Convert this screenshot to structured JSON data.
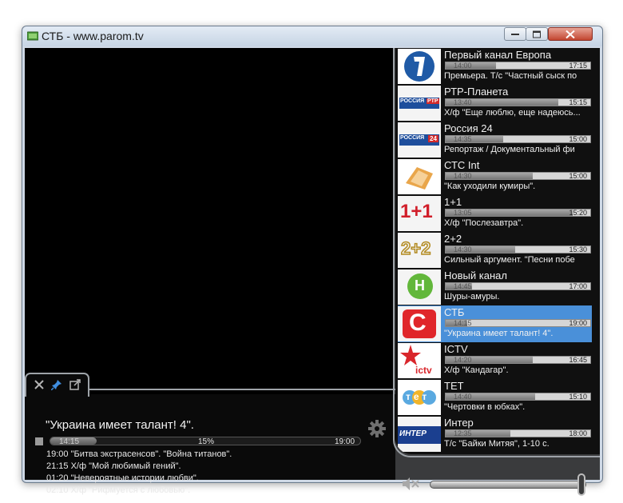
{
  "window": {
    "title": "СТБ - www.parom.tv"
  },
  "info": {
    "current_title": "\"Украина имеет талант! 4\".",
    "progress": {
      "start": "14:15",
      "percent_label": "15%",
      "end": "19:00",
      "fraction": 0.15
    },
    "schedule": [
      "19:00 \"Битва экстрасенсов\". \"Война титанов\".",
      "21:15 Х/ф \"Мой любимый гений\".",
      "01:20 \"Невероятные истории любви\".",
      "02:10 Х/ф \"Рифмуется с любовью\"."
    ]
  },
  "channels": [
    {
      "name": "Первый канал Европа",
      "start": "14:00",
      "end": "17:15",
      "program": "Премьера. Т/с \"Частный сыск по",
      "fraction": 0.35,
      "logo": "pervyi-logo",
      "active": false
    },
    {
      "name": "РТР-Планета",
      "start": "13:40",
      "end": "15:15",
      "program": "Х/ф \"Еще люблю, еще надеюсь...",
      "fraction": 0.78,
      "logo": "rtr-logo",
      "logo_text": "РОССИЯ",
      "logo_badge": "РТР",
      "active": false
    },
    {
      "name": "Россия 24",
      "start": "14:35",
      "end": "15:00",
      "program": "Репортаж / Документальный фи",
      "fraction": 0.4,
      "logo": "russia24-logo",
      "logo_text": "РОССИЯ",
      "logo_badge": "24",
      "active": false
    },
    {
      "name": "СТС Int",
      "start": "14:30",
      "end": "15:00",
      "program": "\"Как уходили кумиры\".",
      "fraction": 0.6,
      "logo": "sts-int-logo",
      "active": false
    },
    {
      "name": "1+1",
      "start": "13:05",
      "end": "15:20",
      "program": "Х/ф \"Послезавтра\".",
      "fraction": 0.88,
      "logo": "1plus1-logo",
      "logo_text": "1+1",
      "active": false
    },
    {
      "name": "2+2",
      "start": "14:30",
      "end": "15:30",
      "program": "Сильный аргумент. \"Песни побе",
      "fraction": 0.48,
      "logo": "2plus2-logo",
      "logo_text": "2+2",
      "active": false
    },
    {
      "name": "Новый канал",
      "start": "14:45",
      "end": "17:00",
      "program": "Шуры-амуры.",
      "fraction": 0.18,
      "logo": "novyi-logo",
      "logo_text": "Н",
      "active": false
    },
    {
      "name": "СТБ",
      "start": "14:15",
      "end": "19:00",
      "program": "\"Украина имеет талант! 4\".",
      "fraction": 0.15,
      "logo": "stb-logo",
      "logo_text": "С",
      "active": true
    },
    {
      "name": "ICTV",
      "start": "14:20",
      "end": "16:45",
      "program": "Х/ф \"Кандагар\".",
      "fraction": 0.6,
      "logo": "ictv-logo",
      "logo_text": "ictv",
      "active": false
    },
    {
      "name": "ТЕТ",
      "start": "14:40",
      "end": "15:10",
      "program": "\"Чертовки в юбках\".",
      "fraction": 0.62,
      "logo": "tet-logo",
      "logo_text": "тет",
      "active": false
    },
    {
      "name": "Интер",
      "start": "12:35",
      "end": "18:00",
      "program": "Т/с \"Байки Митяя\", 1-10 с.",
      "fraction": 0.45,
      "logo": "inter-logo",
      "logo_text": "ИНТЕР",
      "active": false
    }
  ],
  "volume": {
    "level": 0.95
  },
  "colors": {
    "active_row": "#4a90d9",
    "frame": "#3a3b3d"
  }
}
